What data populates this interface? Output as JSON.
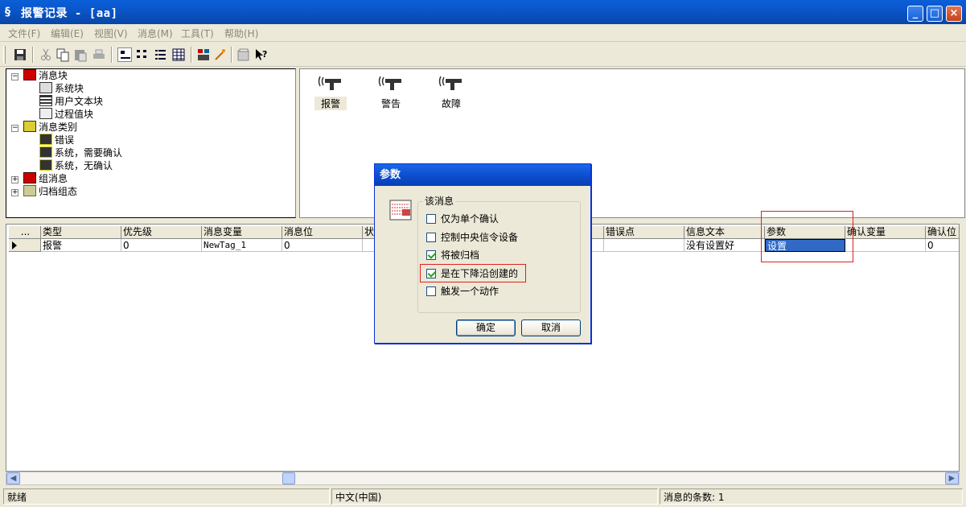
{
  "window": {
    "title": "报警记录 - [aa]",
    "buttons": {
      "minimize": "_",
      "maximize": "□",
      "close": "×"
    }
  },
  "menu": [
    "文件(F)",
    "编辑(E)",
    "视图(V)",
    "消息(M)",
    "工具(T)",
    "帮助(H)"
  ],
  "toolbar": {
    "icons": [
      "save-icon",
      "cut-icon",
      "copy-icon",
      "paste-icon",
      "print-icon",
      "large-icons-icon",
      "small-icons-icon",
      "list-icon",
      "details-icon",
      "alarm-logging-icon",
      "wizard-icon",
      "properties-icon",
      "help-icon"
    ]
  },
  "tree": {
    "root1": "消息块",
    "root1_children": [
      "系统块",
      "用户文本块",
      "过程值块"
    ],
    "root2": "消息类别",
    "root2_children": [
      "错误",
      "系统，需要确认",
      "系统，无确认"
    ],
    "root3": "组消息",
    "root4": "归档组态"
  },
  "icon_pane": {
    "items": [
      "报警",
      "警告",
      "故障"
    ]
  },
  "grid": {
    "corner": "...",
    "columns": [
      "类型",
      "优先级",
      "消息变量",
      "消息位",
      "状",
      "错误点",
      "信息文本",
      "参数",
      "确认变量",
      "确认位"
    ],
    "row": {
      "type": "报警",
      "priority": "0",
      "message_tag": "NewTag_1",
      "message_bit": "0",
      "info_text": "没有设置好",
      "param": "设置",
      "ack_bit": "0"
    }
  },
  "statusbar": {
    "ready": "就绪",
    "language": "中文(中国)",
    "count_label": "消息的条数: 1"
  },
  "dialog": {
    "title": "参数",
    "group_label": "该消息",
    "options": [
      {
        "label": "仅为单个确认",
        "checked": false
      },
      {
        "label": "控制中央信令设备",
        "checked": false
      },
      {
        "label": "将被归档",
        "checked": true
      },
      {
        "label": "是在下降沿创建的",
        "checked": true
      },
      {
        "label": "触发一个动作",
        "checked": false
      }
    ],
    "ok": "确定",
    "cancel": "取消"
  },
  "colors": {
    "titlebar": "#0a55c8",
    "selection": "#316ac5",
    "highlight_box": "#e02020",
    "face": "#ece9d8"
  }
}
